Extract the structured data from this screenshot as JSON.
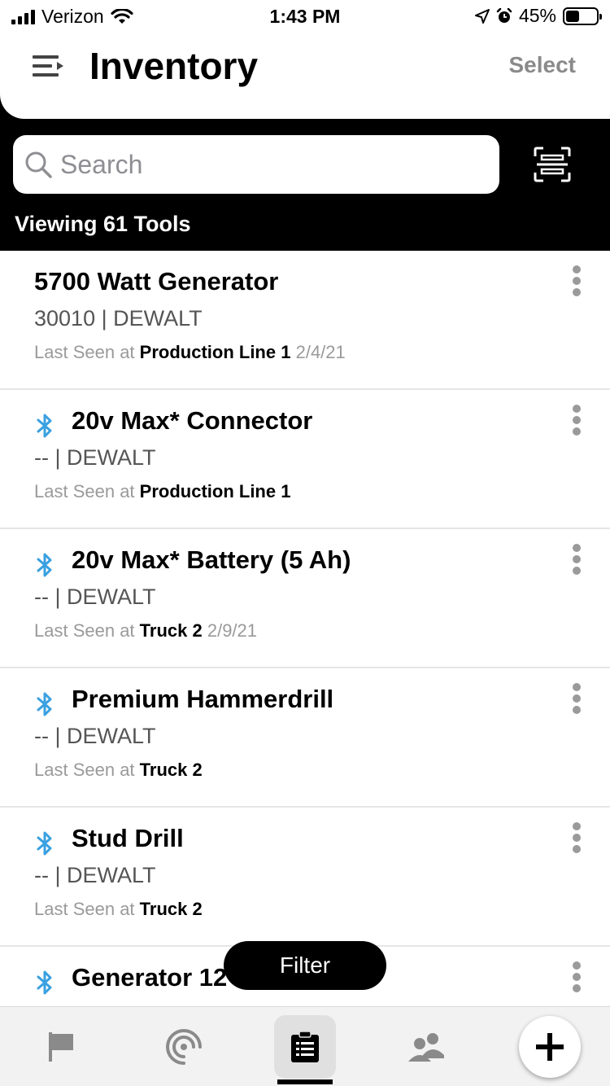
{
  "status_bar": {
    "carrier": "Verizon",
    "time": "1:43 PM",
    "battery": "45%"
  },
  "header": {
    "title": "Inventory",
    "select_label": "Select"
  },
  "search": {
    "placeholder": "Search"
  },
  "viewing_label": "Viewing 61 Tools",
  "items": [
    {
      "name": "5700 Watt Generator",
      "subtitle": "30010 | DEWALT",
      "seen_prefix": "Last Seen at",
      "location": "Production Line 1",
      "date": "2/4/21",
      "bluetooth": false
    },
    {
      "name": "20v Max* Connector",
      "subtitle": "-- | DEWALT",
      "seen_prefix": "Last Seen at",
      "location": "Production Line 1",
      "date": "",
      "bluetooth": true
    },
    {
      "name": "20v Max* Battery (5 Ah)",
      "subtitle": "-- | DEWALT",
      "seen_prefix": "Last Seen at",
      "location": "Truck 2",
      "date": "2/9/21",
      "bluetooth": true
    },
    {
      "name": "Premium Hammerdrill",
      "subtitle": "-- | DEWALT",
      "seen_prefix": "Last Seen at",
      "location": "Truck 2",
      "date": "",
      "bluetooth": true
    },
    {
      "name": "Stud Drill",
      "subtitle": "-- | DEWALT",
      "seen_prefix": "Last Seen at",
      "location": "Truck 2",
      "date": "",
      "bluetooth": true
    },
    {
      "name": "Generator 12",
      "subtitle": "",
      "seen_prefix": "",
      "location": "",
      "date": "",
      "bluetooth": true
    }
  ],
  "filter_label": "Filter",
  "tabs": [
    {
      "icon": "flag-icon"
    },
    {
      "icon": "radar-icon"
    },
    {
      "icon": "clipboard-list-icon",
      "active": true
    },
    {
      "icon": "people-icon"
    },
    {
      "icon": "plus-icon"
    }
  ],
  "colors": {
    "bluetooth": "#3aa0e0",
    "muted": "#9a9a9a",
    "header_bg": "#ffffff",
    "search_zone_bg": "#000000"
  }
}
